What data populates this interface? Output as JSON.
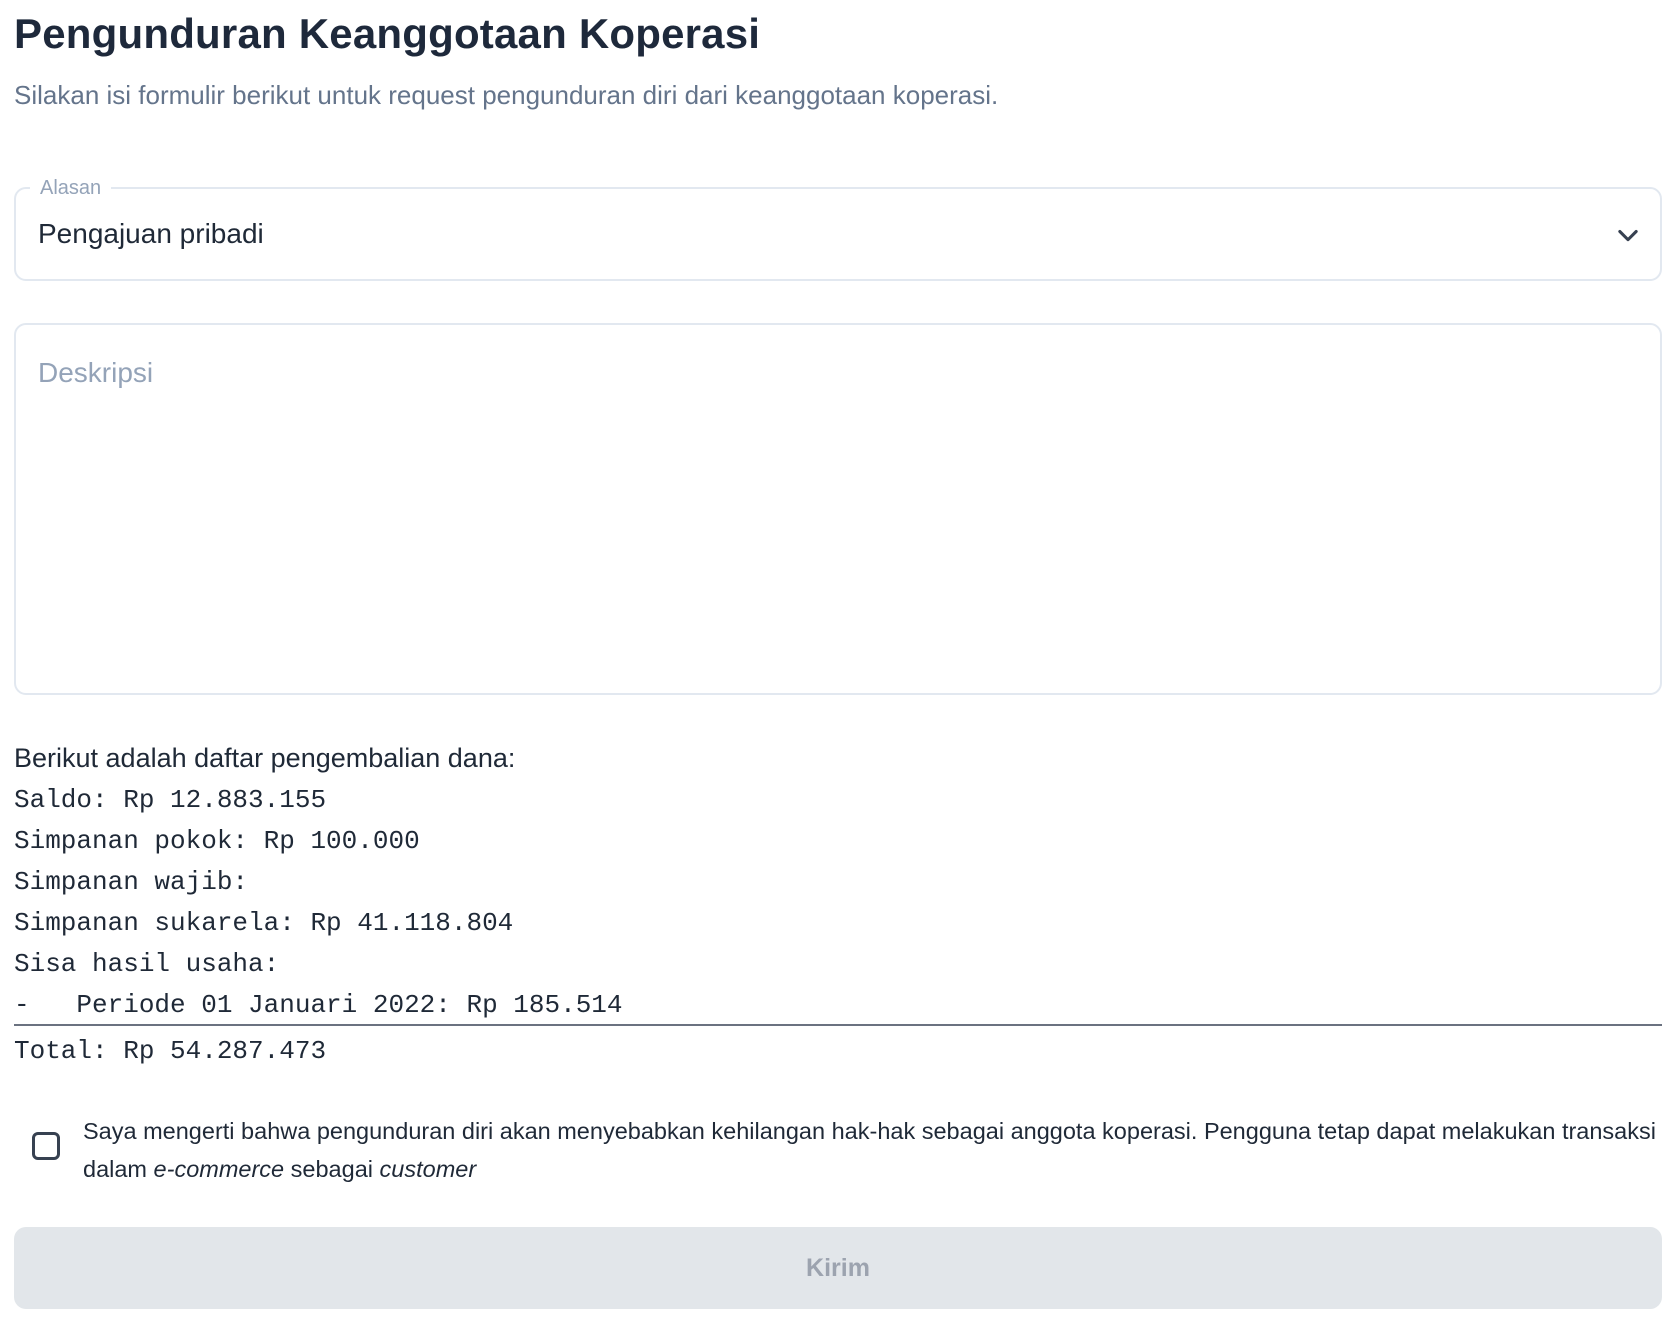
{
  "header": {
    "title": "Pengunduran Keanggotaan Koperasi",
    "subtitle": "Silakan isi formulir berikut untuk request pengunduran diri dari keanggotaan koperasi."
  },
  "form": {
    "reason": {
      "label": "Alasan",
      "selected": "Pengajuan pribadi",
      "icon": "chevron-down-icon"
    },
    "description": {
      "placeholder": "Deskripsi",
      "value": ""
    }
  },
  "refund": {
    "intro": "Berikut adalah daftar pengembalian dana:",
    "lines": [
      "Saldo: Rp 12.883.155",
      "Simpanan pokok: Rp 100.000",
      "Simpanan wajib:",
      "Simpanan sukarela: Rp 41.118.804",
      "Sisa hasil usaha:",
      "-   Periode 01 Januari 2022: Rp 185.514"
    ],
    "total": "Total: Rp 54.287.473"
  },
  "consent": {
    "checked": false,
    "text_part1": "Saya mengerti bahwa pengunduran diri akan menyebabkan kehilangan hak-hak sebagai anggota koperasi. Pengguna tetap dapat melakukan transaksi dalam ",
    "text_em1": "e-commerce",
    "text_part2": " sebagai ",
    "text_em2": "customer"
  },
  "submit": {
    "label": "Kirim",
    "disabled": true
  },
  "colors": {
    "title": "#1e293b",
    "subtitle": "#64748b",
    "border": "#e2e8f0",
    "button_bg": "#e2e6ea",
    "button_text": "#9ca3af"
  }
}
